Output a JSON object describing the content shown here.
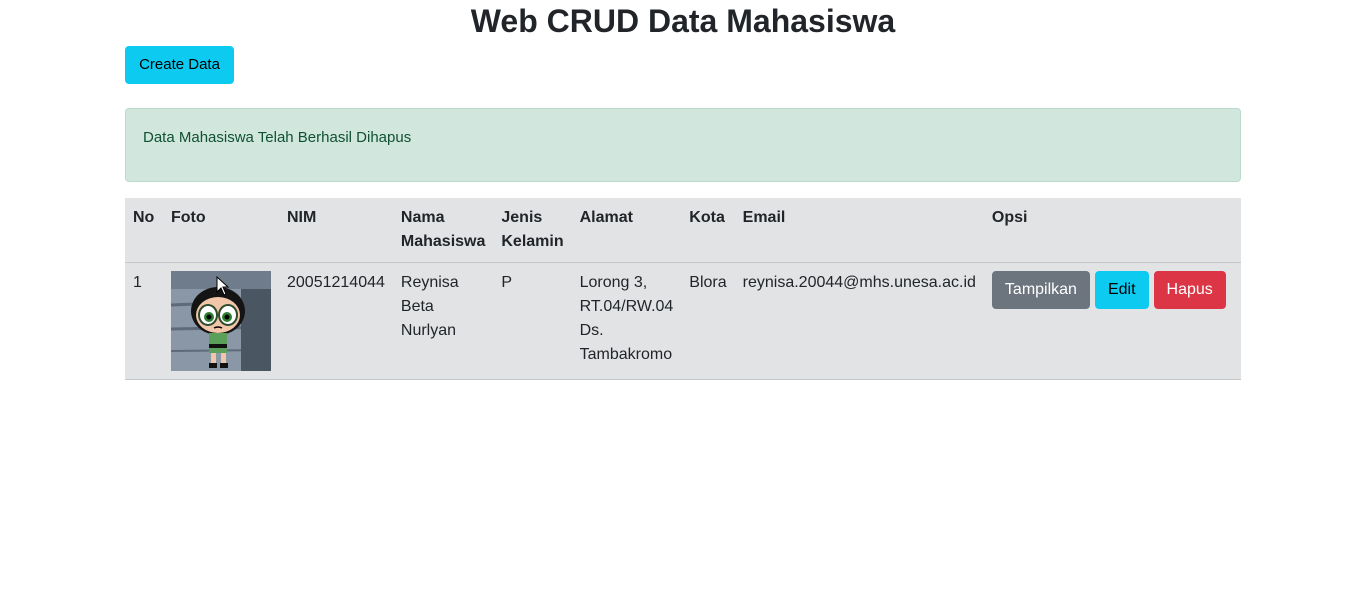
{
  "page": {
    "title": "Web CRUD Data Mahasiswa",
    "create_label": "Create Data",
    "alert_message": "Data Mahasiswa Telah Berhasil Dihapus"
  },
  "table": {
    "headers": {
      "no": "No",
      "foto": "Foto",
      "nim": "NIM",
      "nama": "Nama Mahasiswa",
      "jenis": "Jenis Kelamin",
      "alamat": "Alamat",
      "kota": "Kota",
      "email": "Email",
      "opsi": "Opsi"
    },
    "rows": [
      {
        "no": "1",
        "foto_alt": "Buttercup cartoon photo",
        "nim": "20051214044",
        "nama": "Reynisa Beta Nurlyan",
        "jenis": "P",
        "alamat": "Lorong 3, RT.04/RW.04 Ds. Tambakromo",
        "kota": "Blora",
        "email": "reynisa.20044@mhs.unesa.ac.id",
        "tampilkan_label": "Tampilkan",
        "edit_label": "Edit",
        "hapus_label": "Hapus"
      }
    ]
  },
  "colors": {
    "info": "#0dcaf0",
    "secondary": "#6c757d",
    "danger": "#dc3545",
    "success_bg": "#d1e7dd",
    "table_bg": "#e2e3e5"
  }
}
